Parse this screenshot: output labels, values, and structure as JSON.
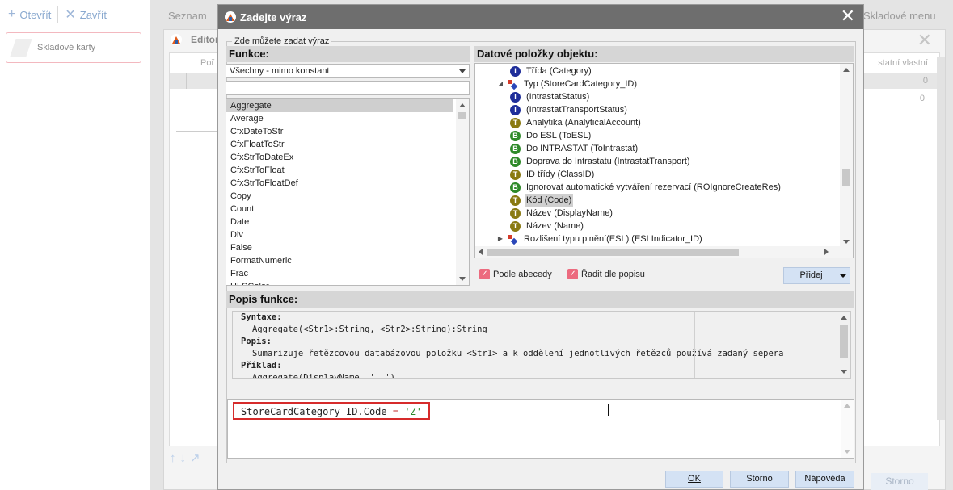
{
  "background": {
    "toolbar": {
      "open_label": "Otevřít",
      "close_label": "Zavřít"
    },
    "card_label": "Skladové karty",
    "tabs": [
      "Seznam"
    ],
    "right_tab": "Skladové menu",
    "editor_title": "Editor v",
    "col_left": "Poř",
    "col_right": "statní vlastní",
    "values": [
      "0",
      "0"
    ],
    "storno_label": "Storno"
  },
  "dialog": {
    "title": "Zadejte výraz",
    "group_label": "Zde můžete zadat výraz",
    "functions": {
      "header": "Funkce:",
      "filter_selected": "Všechny - mimo konstant",
      "search_value": "",
      "items": [
        "Aggregate",
        "Average",
        "CfxDateToStr",
        "CfxFloatToStr",
        "CfxStrToDateEx",
        "CfxStrToFloat",
        "CfxStrToFloatDef",
        "Copy",
        "Count",
        "Date",
        "Div",
        "False",
        "FormatNumeric",
        "Frac",
        "HLSColor"
      ],
      "selected_index": 0
    },
    "data_items": {
      "header": "Datové položky objektu:",
      "rows": [
        {
          "icon": "I",
          "text": "Třída  (Category)",
          "level": 2,
          "twisty": ""
        },
        {
          "icon": "O",
          "text": "Typ  (StoreCardCategory_ID)",
          "level": 1,
          "twisty": "◢"
        },
        {
          "icon": "I",
          "text": "(IntrastatStatus)",
          "level": 2,
          "twisty": ""
        },
        {
          "icon": "I",
          "text": "(IntrastatTransportStatus)",
          "level": 2,
          "twisty": ""
        },
        {
          "icon": "T",
          "text": "Analytika  (AnalyticalAccount)",
          "level": 2,
          "twisty": ""
        },
        {
          "icon": "B",
          "text": "Do ESL  (ToESL)",
          "level": 2,
          "twisty": ""
        },
        {
          "icon": "B",
          "text": "Do INTRASTAT  (ToIntrastat)",
          "level": 2,
          "twisty": ""
        },
        {
          "icon": "B",
          "text": "Doprava do Intrastatu  (IntrastatTransport)",
          "level": 2,
          "twisty": ""
        },
        {
          "icon": "T",
          "text": "ID třídy  (ClassID)",
          "level": 2,
          "twisty": ""
        },
        {
          "icon": "B",
          "text": "Ignorovat automatické vytváření rezervací  (ROIgnoreCreateRes)",
          "level": 2,
          "twisty": ""
        },
        {
          "icon": "T",
          "text": "Kód  (Code)",
          "level": 2,
          "twisty": "",
          "selected": true
        },
        {
          "icon": "T",
          "text": "Název  (DisplayName)",
          "level": 2,
          "twisty": ""
        },
        {
          "icon": "T",
          "text": "Název  (Name)",
          "level": 2,
          "twisty": ""
        },
        {
          "icon": "O",
          "text": "Rozlišení typu plnění(ESL)  (ESLIndicator_ID)",
          "level": 1,
          "twisty": "▶"
        }
      ],
      "sort_alpha_label": "Podle abecedy",
      "sort_desc_label": "Řadit dle popisu",
      "add_button": "Přidej"
    },
    "description": {
      "header": "Popis funkce:",
      "lines": [
        {
          "t": "Syntaxe:",
          "h": true
        },
        {
          "t": "Aggregate(<Str1>:String, <Str2>:String):String",
          "h": false
        },
        {
          "t": "Popis:",
          "h": true
        },
        {
          "t": "Sumarizuje řetězcovou databázovou položku <Str1> a k oddělení jednotlivých řetězců používá zadaný sepera",
          "h": false
        },
        {
          "t": "Příklad:",
          "h": true
        },
        {
          "t": "Aggregate(DisplayName, ', ')",
          "h": false
        }
      ]
    },
    "expression": {
      "field": "StoreCardCategory_ID.Code",
      "operator": "=",
      "value": "'Z'"
    },
    "buttons": {
      "ok": "OK",
      "cancel": "Storno",
      "help": "Nápověda"
    }
  }
}
